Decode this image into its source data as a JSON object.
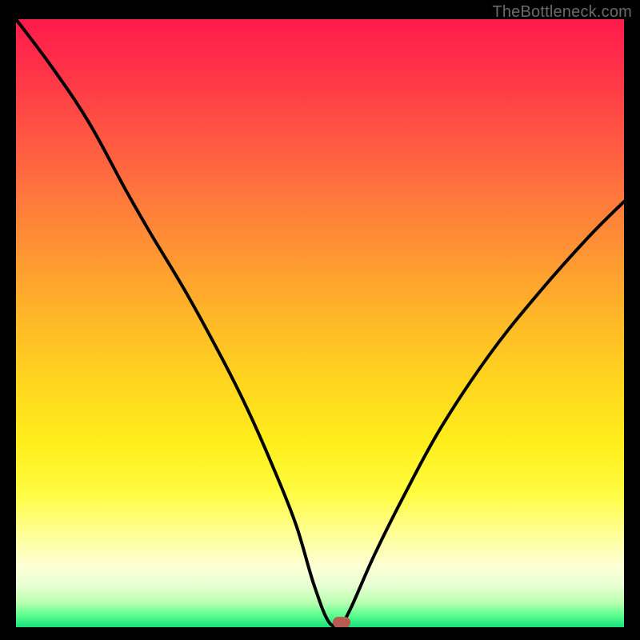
{
  "watermark_text": "TheBottleneck.com",
  "colors": {
    "page_bg": "#000000",
    "watermark": "#6a6a6a",
    "curve_stroke": "#000000",
    "pill_fill": "#b65a52",
    "gradient_top": "#ff1b4a",
    "gradient_bottom": "#18e07a"
  },
  "chart_data": {
    "type": "line",
    "title": "",
    "xlabel": "",
    "ylabel": "",
    "xlim": [
      0,
      100
    ],
    "ylim": [
      0,
      100
    ],
    "grid": false,
    "legend": false,
    "series": [
      {
        "name": "bottleneck-curve",
        "x": [
          0,
          6,
          12,
          18,
          22,
          28,
          34,
          38,
          42,
          46,
          49,
          51.5,
          53.5,
          55,
          59,
          64,
          70,
          78,
          86,
          94,
          100
        ],
        "values": [
          100,
          92,
          83,
          72,
          65,
          55,
          44,
          36,
          27,
          17,
          7,
          0.8,
          0.8,
          3,
          12,
          22,
          33,
          45,
          55,
          64,
          70
        ]
      }
    ],
    "marker": {
      "x": 53.5,
      "y": 0.8,
      "shape": "rounded-pill"
    },
    "flat_segment": {
      "x_start": 51.5,
      "x_end": 53.5,
      "y": 0.8
    }
  }
}
